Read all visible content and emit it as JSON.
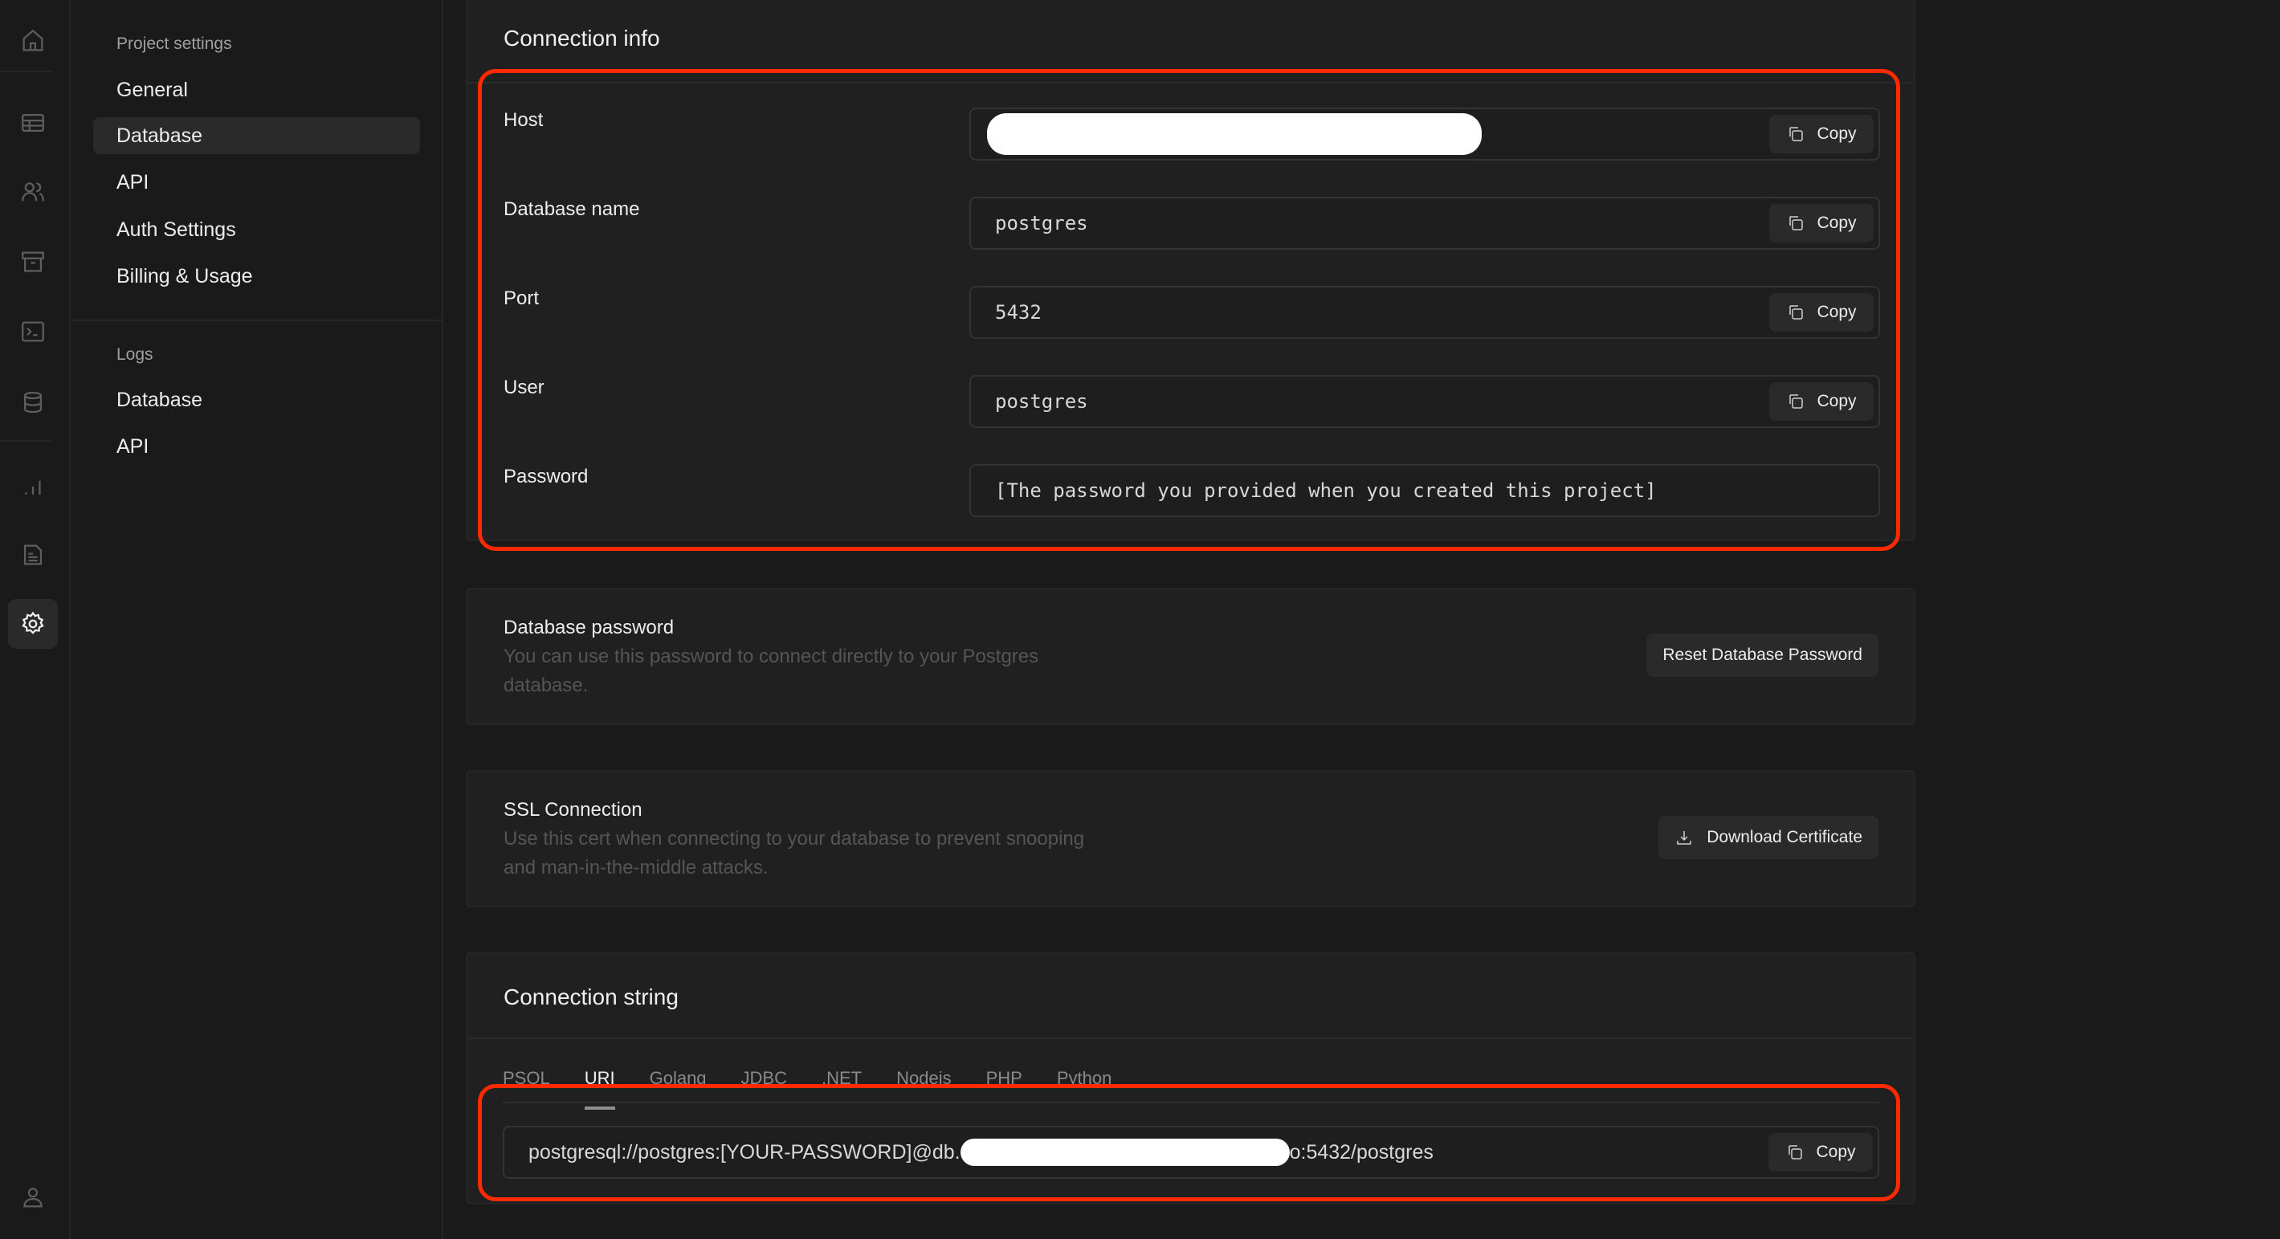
{
  "rail": {
    "icons": [
      "home-icon",
      "table-editor-icon",
      "users-icon",
      "storage-icon",
      "sql-editor-icon",
      "database-icon",
      "reports-icon",
      "docs-icon",
      "settings-icon",
      "profile-icon"
    ],
    "active": "settings-icon"
  },
  "menu": {
    "project_settings_heading": "Project settings",
    "project_settings_items": [
      {
        "label": "General"
      },
      {
        "label": "Database",
        "active": true
      },
      {
        "label": "API"
      },
      {
        "label": "Auth Settings"
      },
      {
        "label": "Billing & Usage"
      }
    ],
    "logs_heading": "Logs",
    "logs_items": [
      {
        "label": "Database"
      },
      {
        "label": "API"
      }
    ]
  },
  "connection_info": {
    "title": "Connection info",
    "fields": [
      {
        "label": "Host",
        "value": "",
        "redacted": true,
        "copy_label": "Copy"
      },
      {
        "label": "Database name",
        "value": "postgres",
        "copy_label": "Copy"
      },
      {
        "label": "Port",
        "value": "5432",
        "copy_label": "Copy"
      },
      {
        "label": "User",
        "value": "postgres",
        "copy_label": "Copy"
      },
      {
        "label": "Password",
        "value": "[The password you provided when you created this project]"
      }
    ]
  },
  "database_password": {
    "title": "Database password",
    "description": "You can use this password to connect directly to your Postgres database.",
    "button_label": "Reset Database Password"
  },
  "ssl_connection": {
    "title": "SSL Connection",
    "description": "Use this cert when connecting to your database to prevent snooping and man-in-the-middle attacks.",
    "button_label": "Download Certificate"
  },
  "connection_string": {
    "title": "Connection string",
    "tabs": [
      "PSQL",
      "URI",
      "Golang",
      "JDBC",
      ".NET",
      "Nodejs",
      "PHP",
      "Python"
    ],
    "active_tab": "URI",
    "value_prefix": "postgresql://postgres:[YOUR-PASSWORD]@db.",
    "value_suffix": "o:5432/postgres",
    "copy_label": "Copy"
  },
  "colors": {
    "highlight": "#ff2a00",
    "background": "#1a1a1a",
    "card": "#202020"
  }
}
